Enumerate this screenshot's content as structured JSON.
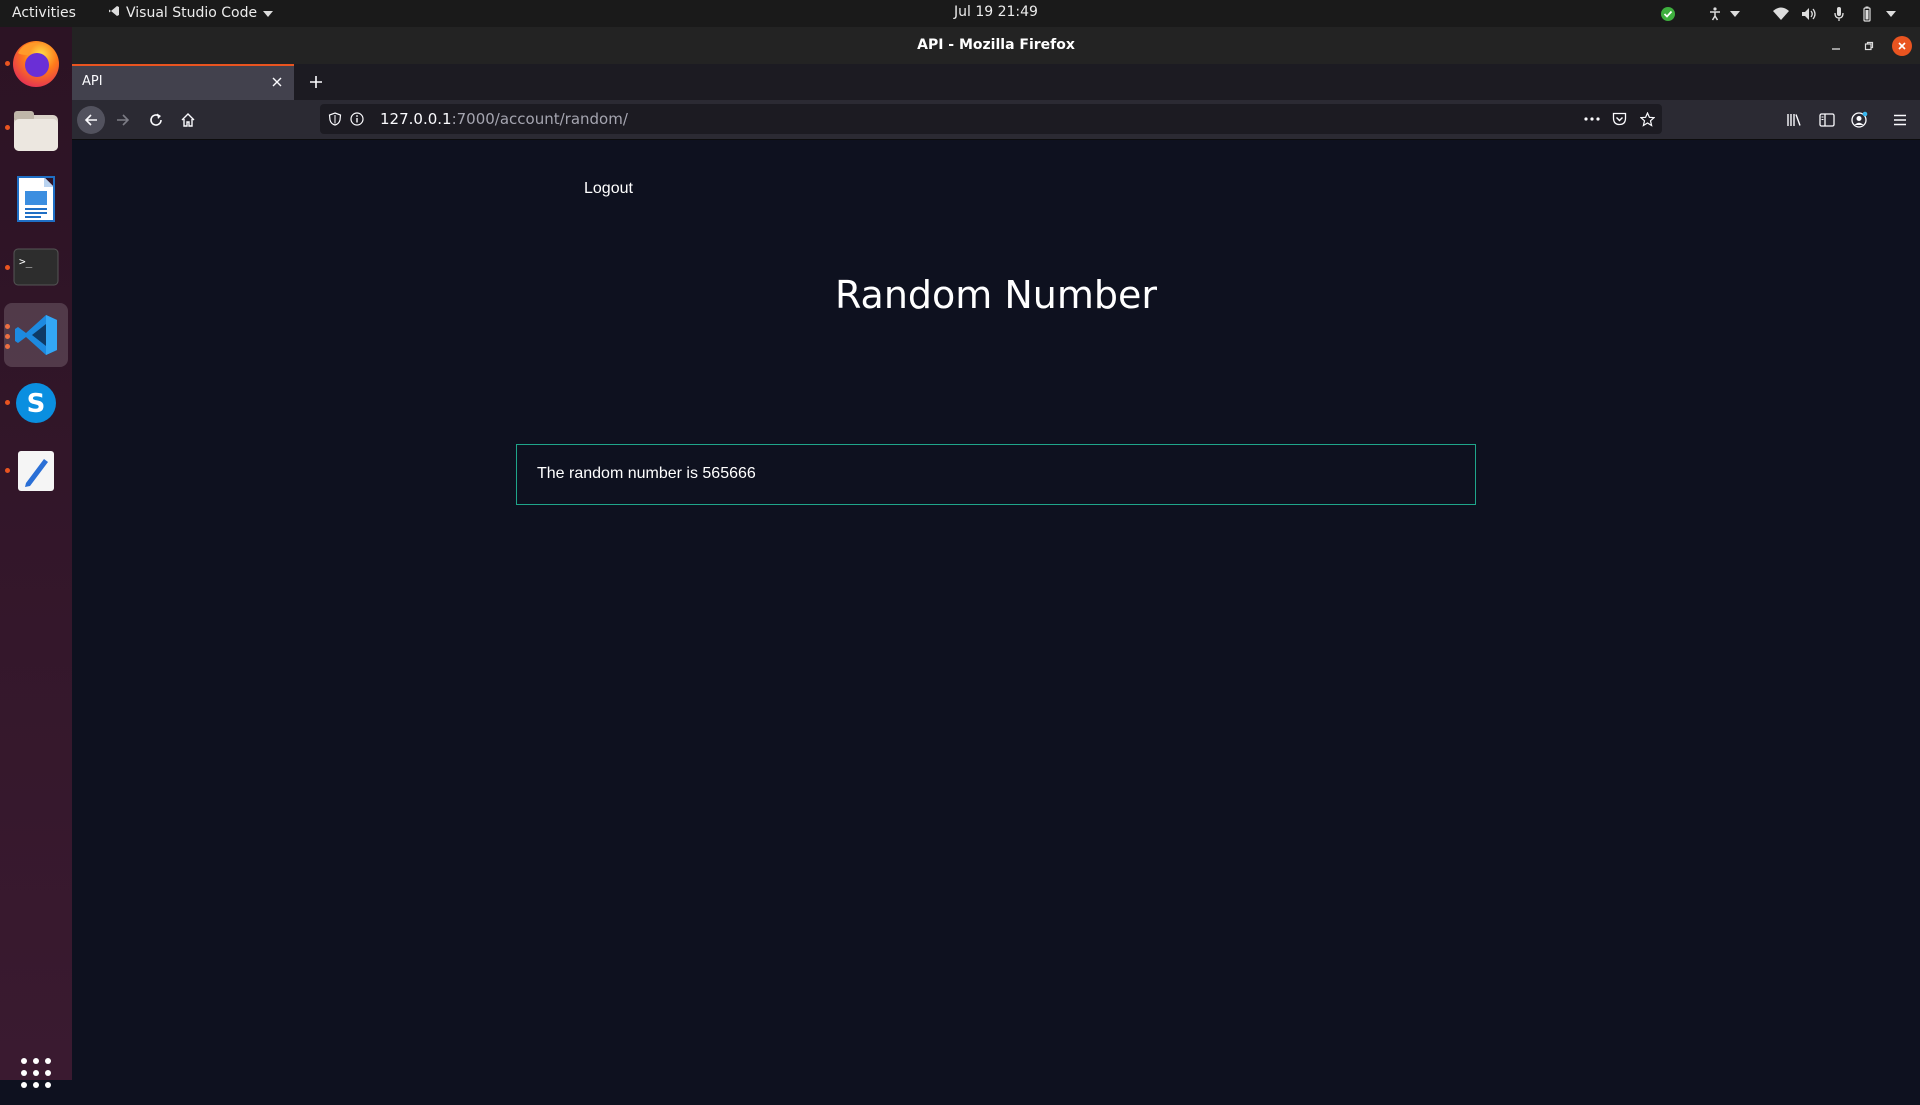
{
  "topbar": {
    "activities": "Activities",
    "app_menu": "Visual Studio Code",
    "clock": "Jul 19  21:49"
  },
  "dock": {
    "items": [
      "firefox-icon",
      "files-icon",
      "libreoffice-writer-icon",
      "terminal-icon",
      "vscode-icon",
      "skype-icon",
      "text-editor-icon"
    ],
    "active": "vscode-icon",
    "accent": "#e95420"
  },
  "window": {
    "title": "API - Mozilla Firefox"
  },
  "tab": {
    "label": "API"
  },
  "url": {
    "host": "127.0.0.1",
    "path": ":7000/account/random/"
  },
  "page": {
    "logout": "Logout",
    "title": "Random Number",
    "result": "The random number is 565666",
    "border_color": "#1fa58a",
    "background": "#0e111f"
  }
}
